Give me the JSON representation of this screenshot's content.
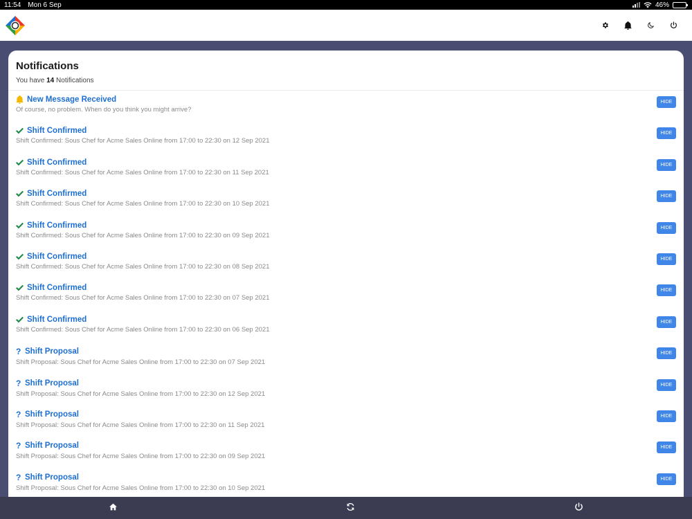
{
  "status": {
    "time": "11:54",
    "date": "Mon 6 Sep",
    "battery": "46%",
    "battery_level": 0.46
  },
  "header": {
    "icons": [
      "app-logo",
      "gear-icon",
      "bell-icon",
      "moon-icon",
      "power-icon"
    ]
  },
  "notifications": {
    "title": "Notifications",
    "count_prefix": "You have",
    "count": "14",
    "count_suffix": "Notifications",
    "hide_label": "HIDE",
    "items": [
      {
        "kind": "message",
        "title": "New Message Received",
        "desc": "Of course, no problem. When do you think you might arrive?"
      },
      {
        "kind": "confirmed",
        "title": "Shift Confirmed",
        "desc": "Shift Confirmed: Sous Chef for Acme Sales Online from 17:00 to 22:30 on 12 Sep 2021"
      },
      {
        "kind": "confirmed",
        "title": "Shift Confirmed",
        "desc": "Shift Confirmed: Sous Chef for Acme Sales Online from 17:00 to 22:30 on 11 Sep 2021"
      },
      {
        "kind": "confirmed",
        "title": "Shift Confirmed",
        "desc": "Shift Confirmed: Sous Chef for Acme Sales Online from 17:00 to 22:30 on 10 Sep 2021"
      },
      {
        "kind": "confirmed",
        "title": "Shift Confirmed",
        "desc": "Shift Confirmed: Sous Chef for Acme Sales Online from 17:00 to 22:30 on 09 Sep 2021"
      },
      {
        "kind": "confirmed",
        "title": "Shift Confirmed",
        "desc": "Shift Confirmed: Sous Chef for Acme Sales Online from 17:00 to 22:30 on 08 Sep 2021"
      },
      {
        "kind": "confirmed",
        "title": "Shift Confirmed",
        "desc": "Shift Confirmed: Sous Chef for Acme Sales Online from 17:00 to 22:30 on 07 Sep 2021"
      },
      {
        "kind": "confirmed",
        "title": "Shift Confirmed",
        "desc": "Shift Confirmed: Sous Chef for Acme Sales Online from 17:00 to 22:30 on 06 Sep 2021"
      },
      {
        "kind": "proposal",
        "title": "Shift Proposal",
        "desc": "Shift Proposal: Sous Chef for Acme Sales Online from 17:00 to 22:30 on 07 Sep 2021"
      },
      {
        "kind": "proposal",
        "title": "Shift Proposal",
        "desc": "Shift Proposal: Sous Chef for Acme Sales Online from 17:00 to 22:30 on 12 Sep 2021"
      },
      {
        "kind": "proposal",
        "title": "Shift Proposal",
        "desc": "Shift Proposal: Sous Chef for Acme Sales Online from 17:00 to 22:30 on 11 Sep 2021"
      },
      {
        "kind": "proposal",
        "title": "Shift Proposal",
        "desc": "Shift Proposal: Sous Chef for Acme Sales Online from 17:00 to 22:30 on 09 Sep 2021"
      },
      {
        "kind": "proposal",
        "title": "Shift Proposal",
        "desc": "Shift Proposal: Sous Chef for Acme Sales Online from 17:00 to 22:30 on 10 Sep 2021"
      }
    ]
  },
  "bottom_nav": [
    "home-icon",
    "refresh-icon",
    "power-icon"
  ],
  "colors": {
    "accent": "#1d6fd1",
    "button": "#3f86e8",
    "confirmed": "#1e8a44",
    "bell": "#f5b800",
    "background": "#4a4d72",
    "bottom_bar": "#3b3c52"
  }
}
